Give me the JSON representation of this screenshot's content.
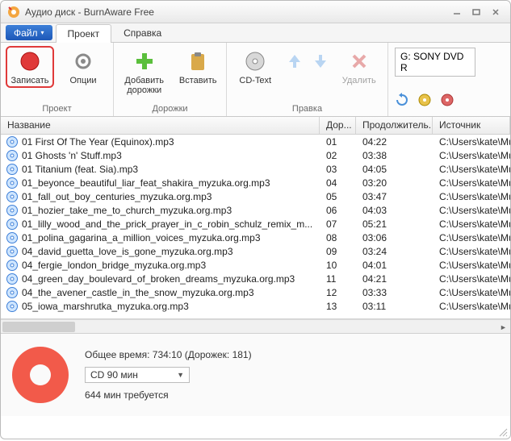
{
  "window": {
    "title": "Аудио диск - BurnAware Free"
  },
  "menu": {
    "file": "Файл",
    "project": "Проект",
    "help": "Справка"
  },
  "ribbon": {
    "project_group": "Проект",
    "tracks_group": "Дорожки",
    "edit_group": "Правка",
    "record": "Записать",
    "options": "Опции",
    "add": "Добавить дорожки",
    "insert": "Вставить",
    "cdtext": "CD-Text",
    "delete": "Удалить",
    "drive": "G: SONY DVD R"
  },
  "columns": {
    "name": "Название",
    "track": "Дор...",
    "duration": "Продолжитель...",
    "source": "Источник"
  },
  "tracks": [
    {
      "name": "01 First Of The Year (Equinox).mp3",
      "no": "01",
      "dur": "04:22",
      "src": "C:\\Users\\kate\\Mus"
    },
    {
      "name": "01 Ghosts 'n' Stuff.mp3",
      "no": "02",
      "dur": "03:38",
      "src": "C:\\Users\\kate\\Mus"
    },
    {
      "name": "01 Titanium (feat. Sia).mp3",
      "no": "03",
      "dur": "04:05",
      "src": "C:\\Users\\kate\\Mus"
    },
    {
      "name": "01_beyonce_beautiful_liar_feat_shakira_myzuka.org.mp3",
      "no": "04",
      "dur": "03:20",
      "src": "C:\\Users\\kate\\Mus"
    },
    {
      "name": "01_fall_out_boy_centuries_myzuka.org.mp3",
      "no": "05",
      "dur": "03:47",
      "src": "C:\\Users\\kate\\Mus"
    },
    {
      "name": "01_hozier_take_me_to_church_myzuka.org.mp3",
      "no": "06",
      "dur": "04:03",
      "src": "C:\\Users\\kate\\Mus"
    },
    {
      "name": "01_lilly_wood_and_the_prick_prayer_in_c_robin_schulz_remix_m...",
      "no": "07",
      "dur": "05:21",
      "src": "C:\\Users\\kate\\Mus"
    },
    {
      "name": "01_polina_gagarina_a_million_voices_myzuka.org.mp3",
      "no": "08",
      "dur": "03:06",
      "src": "C:\\Users\\kate\\Mus"
    },
    {
      "name": "04_david_guetta_love_is_gone_myzuka.org.mp3",
      "no": "09",
      "dur": "03:24",
      "src": "C:\\Users\\kate\\Mus"
    },
    {
      "name": "04_fergie_london_bridge_myzuka.org.mp3",
      "no": "10",
      "dur": "04:01",
      "src": "C:\\Users\\kate\\Mus"
    },
    {
      "name": "04_green_day_boulevard_of_broken_dreams_myzuka.org.mp3",
      "no": "11",
      "dur": "04:21",
      "src": "C:\\Users\\kate\\Mus"
    },
    {
      "name": "04_the_avener_castle_in_the_snow_myzuka.org.mp3",
      "no": "12",
      "dur": "03:33",
      "src": "C:\\Users\\kate\\Mus"
    },
    {
      "name": "05_iowa_marshrutka_myzuka.org.mp3",
      "no": "13",
      "dur": "03:11",
      "src": "C:\\Users\\kate\\Mus"
    }
  ],
  "footer": {
    "total": "Общее время: 734:10 (Дорожек: 181)",
    "disc_type": "CD 90 мин",
    "required": "644 мин требуется"
  }
}
